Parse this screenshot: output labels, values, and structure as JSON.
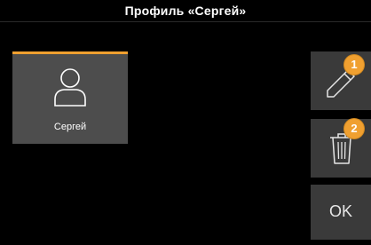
{
  "header": {
    "title": "Профиль «Сергей»"
  },
  "profile": {
    "name": "Сергей",
    "avatar_icon": "user-icon",
    "accent_color": "#f0a030"
  },
  "actions": {
    "edit": {
      "icon": "pencil-icon",
      "badge": "1"
    },
    "delete": {
      "icon": "trash-icon",
      "badge": "2"
    },
    "ok": {
      "label": "OK"
    }
  }
}
